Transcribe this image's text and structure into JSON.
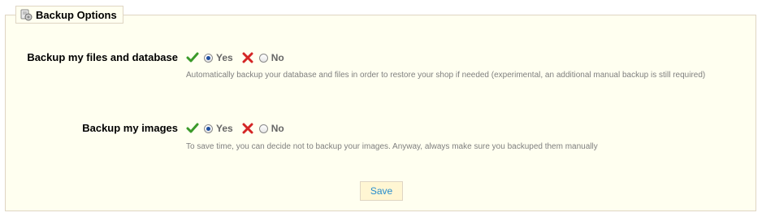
{
  "legend": {
    "icon": "backup-icon",
    "title": "Backup Options"
  },
  "fields": [
    {
      "label": "Backup my files and database",
      "selected": "Yes",
      "yes_label": "Yes",
      "no_label": "No",
      "hint": "Automatically backup your database and files in order to restore your shop if needed (experimental, an additional manual backup is still required)"
    },
    {
      "label": "Backup my images",
      "selected": "Yes",
      "yes_label": "Yes",
      "no_label": "No",
      "hint": "To save time, you can decide not to backup your images. Anyway, always make sure you backuped them manually"
    }
  ],
  "save_label": "Save",
  "colors": {
    "accent": "#268ccd",
    "panel": "#fffff0",
    "border": "#dfd5c3",
    "yes": "#3b9a2a",
    "no": "#d42525"
  }
}
